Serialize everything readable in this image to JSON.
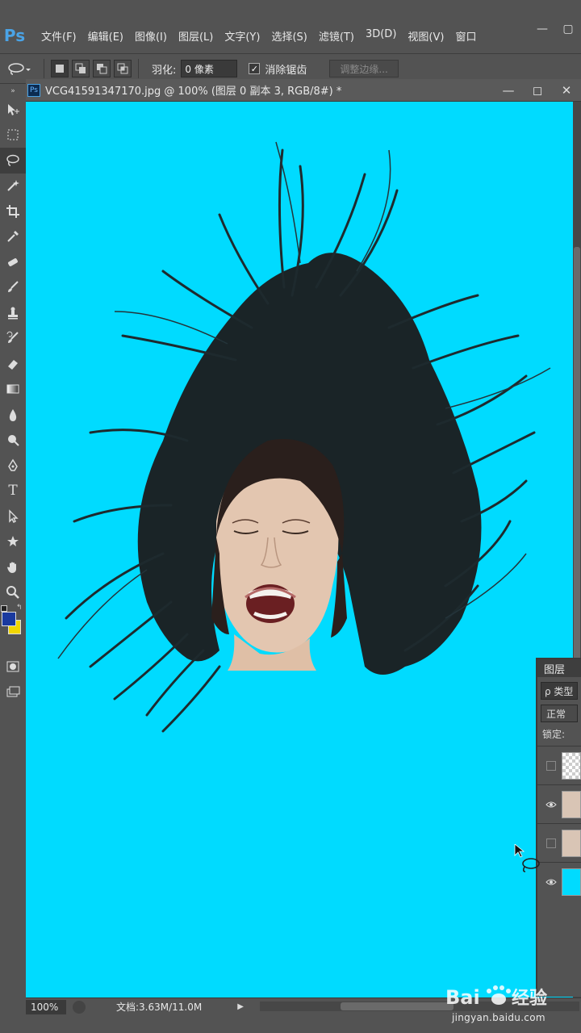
{
  "app": {
    "logo": "Ps",
    "menu": [
      "文件(F)",
      "编辑(E)",
      "图像(I)",
      "图层(L)",
      "文字(Y)",
      "选择(S)",
      "滤镜(T)",
      "3D(D)",
      "视图(V)",
      "窗口"
    ]
  },
  "options": {
    "feather_label": "羽化:",
    "feather_value": "0 像素",
    "antialias_label": "消除锯齿",
    "antialias_checked": "✓",
    "refine_edge_label": "调整边缘..."
  },
  "document": {
    "title": "VCG41591347170.jpg @ 100% (图层 0 副本 3, RGB/8#) *",
    "canvas_color": "#00dbff"
  },
  "status": {
    "zoom": "100%",
    "doc_info": "文档:3.63M/11.0M"
  },
  "layers": {
    "tab": "图层",
    "search_placeholder": "ρ 类型",
    "blend_mode": "正常",
    "lock_label": "锁定:",
    "rows": [
      {
        "name": "transparent-layer",
        "visible": false
      },
      {
        "name": "portrait-layer-copy",
        "visible": true
      },
      {
        "name": "portrait-layer",
        "visible": false
      },
      {
        "name": "cyan-background-layer",
        "visible": true
      }
    ]
  },
  "colors": {
    "foreground": "#1a3a9f",
    "background": "#f1d600"
  },
  "watermark": {
    "url": "jingyan.baidu.com"
  }
}
